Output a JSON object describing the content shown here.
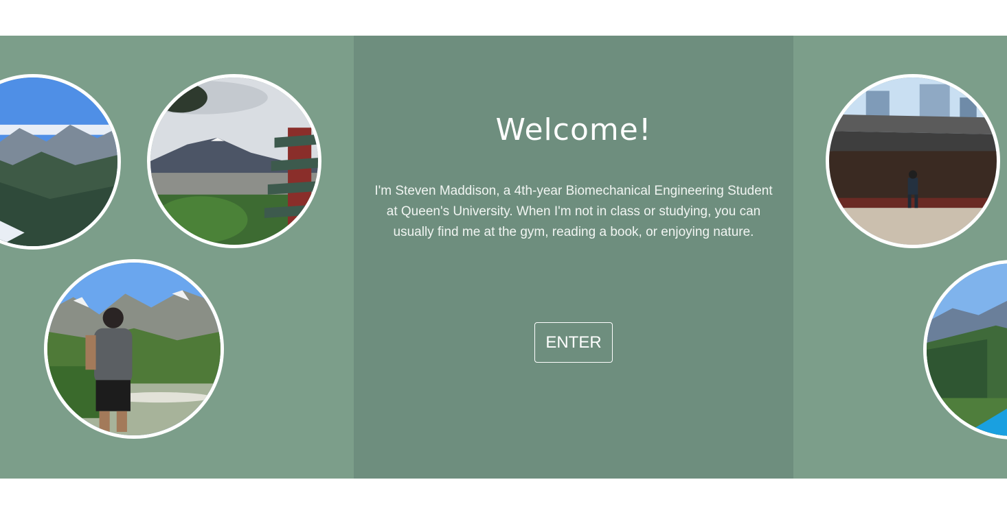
{
  "hero": {
    "title": "Welcome!",
    "intro": "I'm Steven Maddison, a 4th-year Biomechanical Engineering Student at Queen's University. When I'm not in class or studying, you can usually find me at the gym, reading a book, or enjoying nature.",
    "enter_label": "ENTER"
  },
  "colors": {
    "band": "#7c9e8a",
    "center_panel": "#6e8e7e",
    "text": "#ffffff"
  }
}
